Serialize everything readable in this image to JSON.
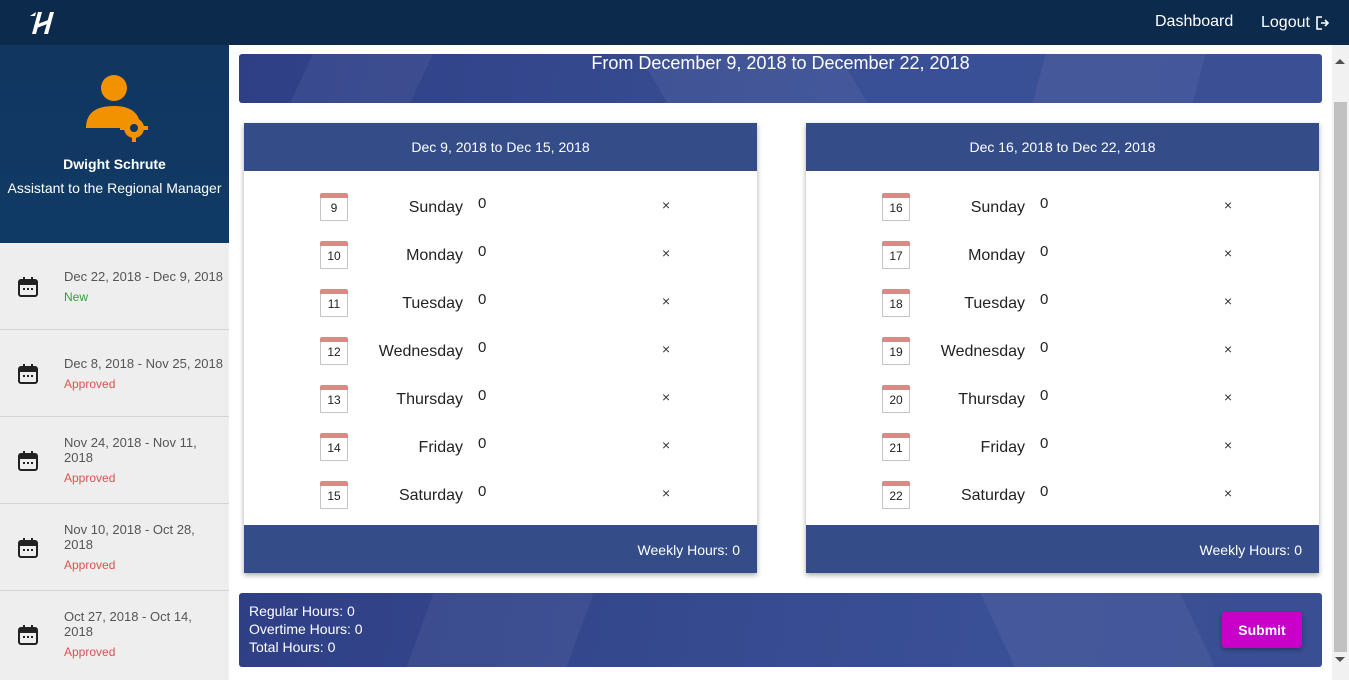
{
  "nav": {
    "dashboard": "Dashboard",
    "logout": "Logout"
  },
  "profile": {
    "name": "Dwight Schrute",
    "role": "Assistant to the Regional Manager"
  },
  "periods": [
    {
      "line1": "Dec 22, 2018 - Dec 9, 2018",
      "line2": "",
      "status": "New"
    },
    {
      "line1": "Dec 8, 2018 - Nov 25, 2018",
      "line2": "",
      "status": "Approved"
    },
    {
      "line1": "Nov 24, 2018 - Nov 11,",
      "line2": "2018",
      "status": "Approved"
    },
    {
      "line1": "Nov 10, 2018 - Oct 28,",
      "line2": "2018",
      "status": "Approved"
    },
    {
      "line1": "Oct 27, 2018 - Oct 14,",
      "line2": "2018",
      "status": "Approved"
    }
  ],
  "banner": "From December 9, 2018 to December 22, 2018",
  "weeks": [
    {
      "title": "Dec 9, 2018 to Dec 15, 2018",
      "footer": "Weekly Hours: 0",
      "days": [
        {
          "num": "9",
          "name": "Sunday",
          "hours": "0"
        },
        {
          "num": "10",
          "name": "Monday",
          "hours": "0"
        },
        {
          "num": "11",
          "name": "Tuesday",
          "hours": "0"
        },
        {
          "num": "12",
          "name": "Wednesday",
          "hours": "0"
        },
        {
          "num": "13",
          "name": "Thursday",
          "hours": "0"
        },
        {
          "num": "14",
          "name": "Friday",
          "hours": "0"
        },
        {
          "num": "15",
          "name": "Saturday",
          "hours": "0"
        }
      ]
    },
    {
      "title": "Dec 16, 2018 to Dec 22, 2018",
      "footer": "Weekly Hours: 0",
      "days": [
        {
          "num": "16",
          "name": "Sunday",
          "hours": "0"
        },
        {
          "num": "17",
          "name": "Monday",
          "hours": "0"
        },
        {
          "num": "18",
          "name": "Tuesday",
          "hours": "0"
        },
        {
          "num": "19",
          "name": "Wednesday",
          "hours": "0"
        },
        {
          "num": "20",
          "name": "Thursday",
          "hours": "0"
        },
        {
          "num": "21",
          "name": "Friday",
          "hours": "0"
        },
        {
          "num": "22",
          "name": "Saturday",
          "hours": "0"
        }
      ]
    }
  ],
  "summary": {
    "regular": "Regular Hours: 0",
    "overtime": "Overtime Hours: 0",
    "total": "Total Hours: 0",
    "submit": "Submit"
  },
  "icons": {
    "remove": "×",
    "logo": "app-logo-icon",
    "logout": "logout-icon",
    "calendar": "calendar-icon",
    "avatar": "user-gear-icon"
  },
  "colors": {
    "topbar": "#0c2a4c",
    "accent_blue": "#344d88",
    "submit": "#c800c8",
    "status_new": "#3a9a3a",
    "status_approved": "#d9534f",
    "avatar": "#f39200"
  }
}
